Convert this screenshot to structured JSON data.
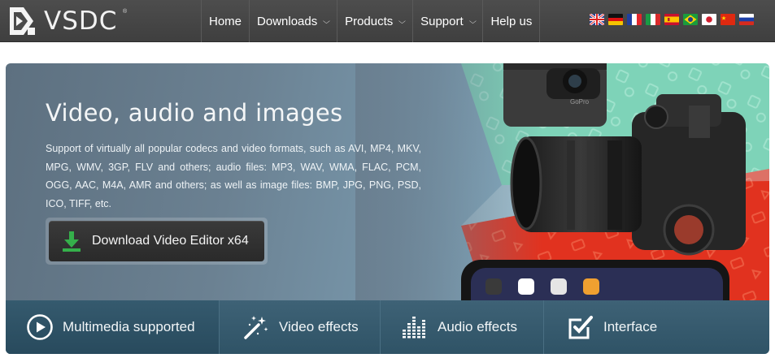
{
  "logo": {
    "text": "VSDC",
    "registered": "®"
  },
  "nav": {
    "items": [
      {
        "label": "Home",
        "dropdown": false
      },
      {
        "label": "Downloads",
        "dropdown": true
      },
      {
        "label": "Products",
        "dropdown": true
      },
      {
        "label": "Support",
        "dropdown": true
      },
      {
        "label": "Help us",
        "dropdown": false
      }
    ],
    "chevron": "⌄"
  },
  "languages": [
    "English",
    "German",
    "French",
    "Italian",
    "Spanish",
    "Portuguese (Brazil)",
    "Japanese",
    "Chinese",
    "Russian"
  ],
  "hero": {
    "title": "Video, audio and images",
    "description": "Support of virtually all popular codecs and video formats, such as AVI, MP4, MKV, MPG, WMV, 3GP, FLV and others; audio files: MP3, WAV, WMA, FLAC, PCM, OGG, AAC, M4A, AMR and others; as well as image files: BMP, JPG, PNG, PSD, ICO, TIFF, etc.",
    "download_label": "Download Video Editor x64",
    "camera_brand": "GoPro"
  },
  "tabs": [
    {
      "label": "Multimedia supported",
      "icon": "play-circle-icon",
      "active": true
    },
    {
      "label": "Video effects",
      "icon": "magic-wand-icon",
      "active": false
    },
    {
      "label": "Audio effects",
      "icon": "equalizer-icon",
      "active": false
    },
    {
      "label": "Interface",
      "icon": "checkbox-edit-icon",
      "active": false
    }
  ],
  "colors": {
    "topbar": "#464646",
    "hero_overlay": "#6b8192",
    "teal_band": "#7fd1b6",
    "red_band": "#e0311f",
    "tabs_bar": "#365a6e",
    "download_icon": "#35b04b"
  }
}
